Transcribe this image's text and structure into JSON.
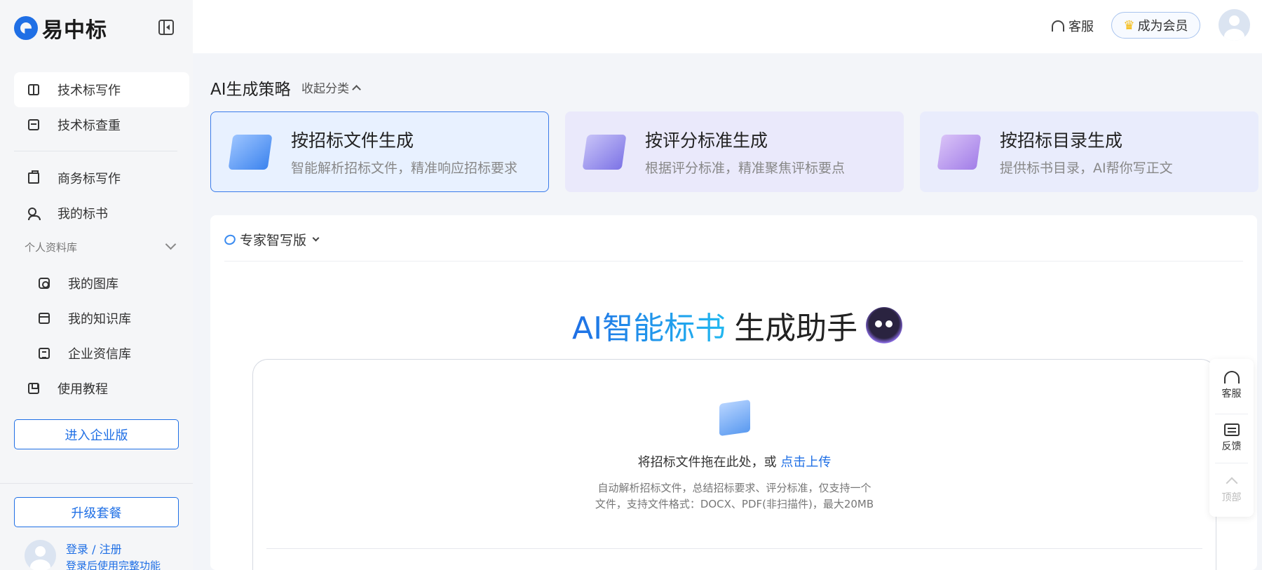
{
  "sidebar": {
    "logo_text": "易中标",
    "items": [
      {
        "label": "技术标写作",
        "icon": "book-icon"
      },
      {
        "label": "技术标查重",
        "icon": "check-doc-icon"
      },
      {
        "label": "商务标写作",
        "icon": "briefcase-icon"
      },
      {
        "label": "我的标书",
        "icon": "user-list-icon"
      }
    ],
    "section_label": "个人资料库",
    "sub_items": [
      {
        "label": "我的图库",
        "icon": "gallery-icon"
      },
      {
        "label": "我的知识库",
        "icon": "folder-icon"
      },
      {
        "label": "企业资信库",
        "icon": "document-icon"
      }
    ],
    "tutorial_label": "使用教程",
    "enterprise_button": "进入企业版",
    "upgrade_button": "升级套餐",
    "login_title": "登录 / 注册",
    "login_sub": "登录后使用完整功能"
  },
  "topbar": {
    "service_label": "客服",
    "vip_label": "成为会员"
  },
  "strategy": {
    "title": "AI生成策略",
    "toggle_label": "收起分类",
    "cards": [
      {
        "title": "按招标文件生成",
        "sub": "智能解析招标文件，精准响应招标要求"
      },
      {
        "title": "按评分标准生成",
        "sub": "根据评分标准，精准聚焦评标要点"
      },
      {
        "title": "按招标目录生成",
        "sub": "提供标书目录，AI帮你写正文"
      }
    ]
  },
  "main": {
    "mode_label": "专家智写版",
    "hero_blue": "AI智能标书",
    "hero_dark": "生成助手",
    "upload_text": "将招标文件拖在此处，或",
    "upload_link": "点击上传",
    "upload_hint": "自动解析招标文件，总结招标要求、评分标准，仅支持一个文件，支持文件格式：DOCX、PDF(非扫描件)，最大20MB"
  },
  "float_bar": {
    "service": "客服",
    "feedback": "反馈",
    "top": "顶部"
  },
  "colors": {
    "accent": "#1f6fe5",
    "sidebar_bg": "#f5f6f8",
    "page_bg": "#f3f5f9"
  }
}
